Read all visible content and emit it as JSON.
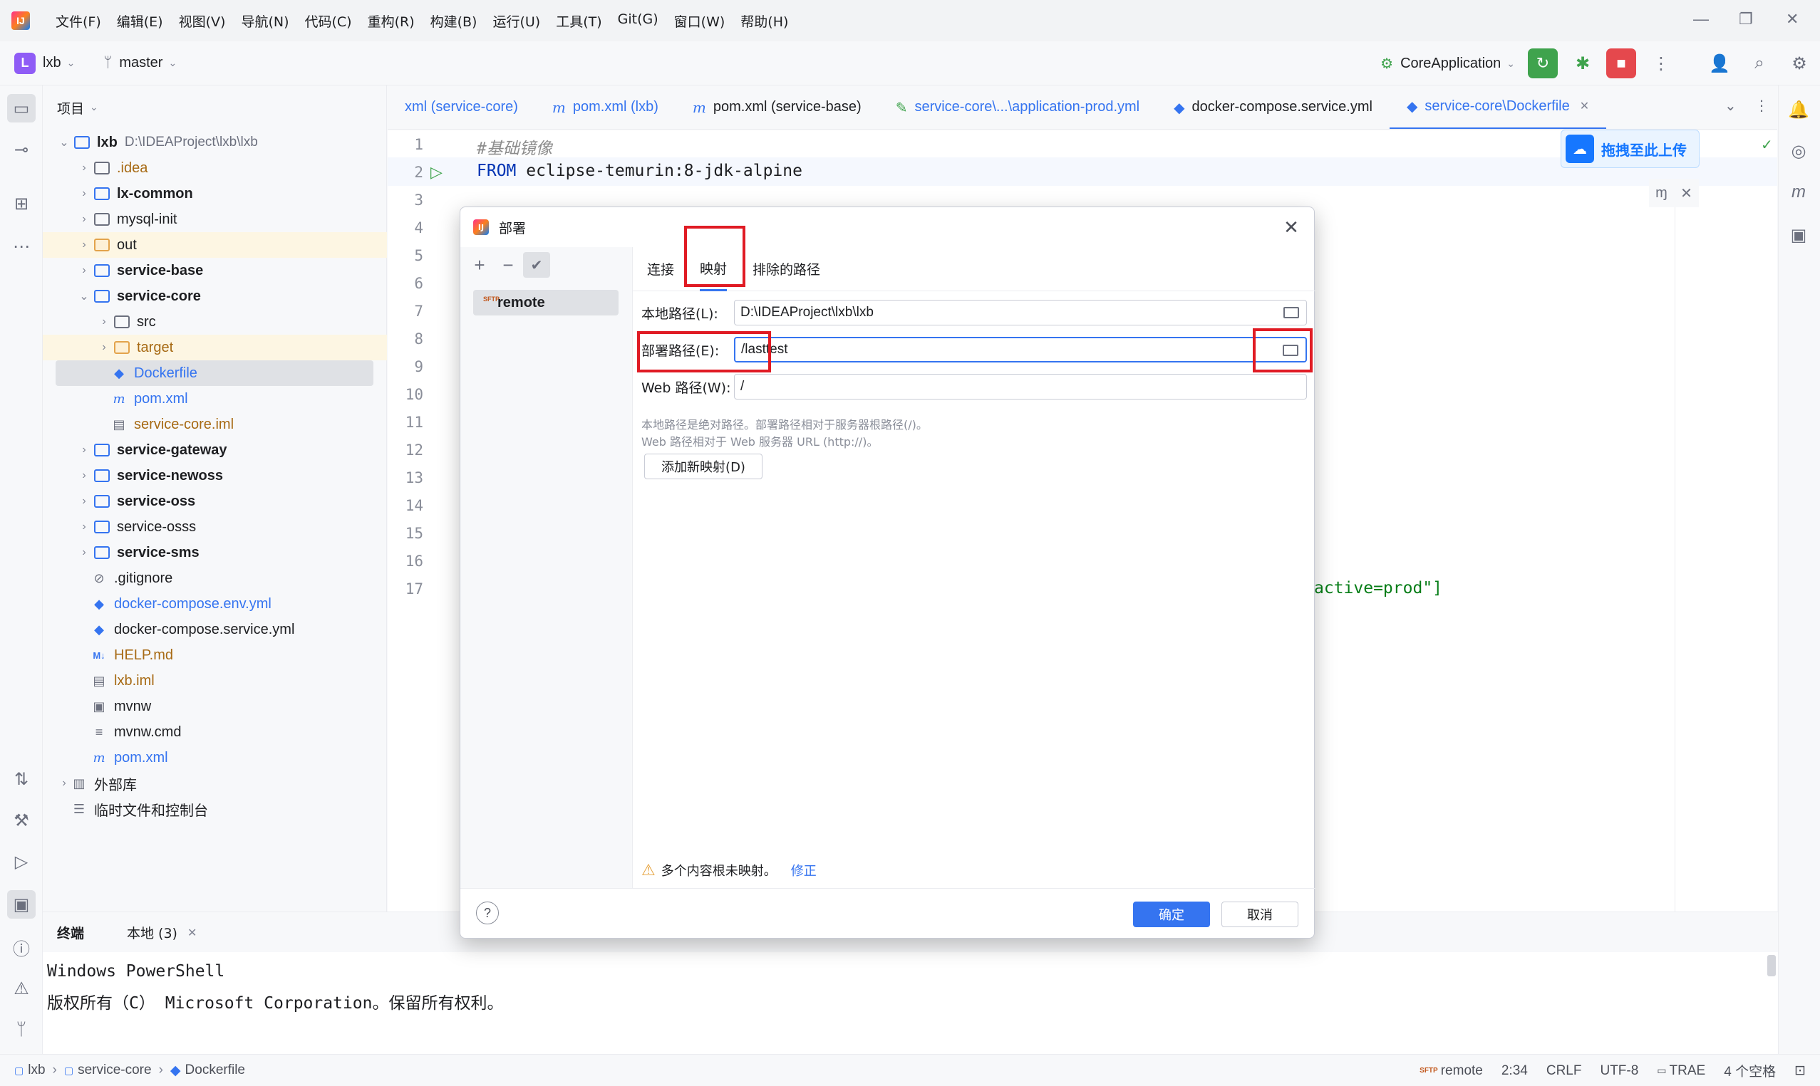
{
  "menu": [
    "文件(F)",
    "编辑(E)",
    "视图(V)",
    "导航(N)",
    "代码(C)",
    "重构(R)",
    "构建(B)",
    "运行(U)",
    "工具(T)",
    "Git(G)",
    "窗口(W)",
    "帮助(H)"
  ],
  "toolbar": {
    "project_badge": "L",
    "project_name": "lxb",
    "branch": "master",
    "run_config": "CoreApplication"
  },
  "project_panel": {
    "title": "项目",
    "tree": [
      {
        "label": "lxb",
        "sub": "D:\\IDEAProject\\lxb\\lxb",
        "depth": 0,
        "arrow": "⌄",
        "icon": "folder-mod",
        "style": "bold"
      },
      {
        "label": ".idea",
        "depth": 1,
        "arrow": "›",
        "icon": "folder",
        "style": "orange"
      },
      {
        "label": "lx-common",
        "depth": 1,
        "arrow": "›",
        "icon": "folder-mod",
        "style": "bold"
      },
      {
        "label": "mysql-init",
        "depth": 1,
        "arrow": "›",
        "icon": "folder",
        "style": ""
      },
      {
        "label": "out",
        "depth": 1,
        "arrow": "›",
        "icon": "folder-orange",
        "style": "",
        "hl": true
      },
      {
        "label": "service-base",
        "depth": 1,
        "arrow": "›",
        "icon": "folder-mod",
        "style": "bold"
      },
      {
        "label": "service-core",
        "depth": 1,
        "arrow": "⌄",
        "icon": "folder-mod",
        "style": "bold"
      },
      {
        "label": "src",
        "depth": 2,
        "arrow": "›",
        "icon": "folder",
        "style": ""
      },
      {
        "label": "target",
        "depth": 2,
        "arrow": "›",
        "icon": "folder-orange",
        "style": "orange",
        "hl": true
      },
      {
        "label": "Dockerfile",
        "depth": 2,
        "arrow": "",
        "icon": "docker",
        "style": "blue",
        "sel": true
      },
      {
        "label": "pom.xml",
        "depth": 2,
        "arrow": "",
        "icon": "maven",
        "style": "blue"
      },
      {
        "label": "service-core.iml",
        "depth": 2,
        "arrow": "",
        "icon": "file",
        "style": "orange"
      },
      {
        "label": "service-gateway",
        "depth": 1,
        "arrow": "›",
        "icon": "folder-mod",
        "style": "bold"
      },
      {
        "label": "service-newoss",
        "depth": 1,
        "arrow": "›",
        "icon": "folder-mod",
        "style": "bold"
      },
      {
        "label": "service-oss",
        "depth": 1,
        "arrow": "›",
        "icon": "folder-mod",
        "style": "bold"
      },
      {
        "label": "service-osss",
        "depth": 1,
        "arrow": "›",
        "icon": "folder-mod",
        "style": ""
      },
      {
        "label": "service-sms",
        "depth": 1,
        "arrow": "›",
        "icon": "folder-mod",
        "style": "bold"
      },
      {
        "label": ".gitignore",
        "depth": 1,
        "arrow": "",
        "icon": "ignore",
        "style": ""
      },
      {
        "label": "docker-compose.env.yml",
        "depth": 1,
        "arrow": "",
        "icon": "docker",
        "style": "blue"
      },
      {
        "label": "docker-compose.service.yml",
        "depth": 1,
        "arrow": "",
        "icon": "docker",
        "style": ""
      },
      {
        "label": "HELP.md",
        "depth": 1,
        "arrow": "",
        "icon": "md",
        "style": "orange"
      },
      {
        "label": "lxb.iml",
        "depth": 1,
        "arrow": "",
        "icon": "file",
        "style": "orange"
      },
      {
        "label": "mvnw",
        "depth": 1,
        "arrow": "",
        "icon": "terminal",
        "style": ""
      },
      {
        "label": "mvnw.cmd",
        "depth": 1,
        "arrow": "",
        "icon": "lines",
        "style": ""
      },
      {
        "label": "pom.xml",
        "depth": 1,
        "arrow": "",
        "icon": "maven",
        "style": "blue"
      },
      {
        "label": "外部库",
        "depth": 0,
        "arrow": "›",
        "icon": "library",
        "style": ""
      },
      {
        "label": "临时文件和控制台",
        "depth": 0,
        "arrow": "",
        "icon": "scratch",
        "style": ""
      }
    ]
  },
  "tabs": [
    {
      "label": "xml (service-core)",
      "icon": "",
      "active": false
    },
    {
      "label": "pom.xml (lxb)",
      "icon": "m",
      "active": false
    },
    {
      "label": "pom.xml (service-base)",
      "icon": "m",
      "active": false,
      "dark": true
    },
    {
      "label": "service-core\\...\\application-prod.yml",
      "icon": "yml",
      "active": false
    },
    {
      "label": "docker-compose.service.yml",
      "icon": "docker",
      "active": false,
      "dark": true
    },
    {
      "label": "service-core\\Dockerfile",
      "icon": "docker",
      "active": true
    }
  ],
  "editor": {
    "line_numbers": [
      "1",
      "2",
      "3",
      "4",
      "5",
      "6",
      "7",
      "8",
      "9",
      "10",
      "11",
      "12",
      "13",
      "14",
      "15",
      "16",
      "17"
    ],
    "line1_comment": "#基础镜像",
    "line2_keyword": "FROM",
    "line2_rest": " eclipse-temurin:8-jdk-alpine",
    "line17_tail": "active=prod\"]",
    "upload_label": "拖拽至此上传"
  },
  "dialog": {
    "title": "部署",
    "server": "remote",
    "tabs": [
      "连接",
      "映射",
      "排除的路径"
    ],
    "active_tab": "映射",
    "local_path_label": "本地路径(L):",
    "local_path": "D:\\IDEAProject\\lxb\\lxb",
    "deploy_path_label": "部署路径(E):",
    "deploy_path": "/lasttest",
    "web_path_label": "Web 路径(W):",
    "web_path": "/",
    "hint1": "本地路径是绝对路径。部署路径相对于服务器根路径(/)。",
    "hint2": "Web 路径相对于 Web 服务器 URL (http://)。",
    "add_mapping": "添加新映射(D)",
    "warning": "多个内容根未映射。",
    "fix_link": "修正",
    "ok": "确定",
    "cancel": "取消"
  },
  "terminal": {
    "title": "终端",
    "tab": "本地 (3)",
    "lines": [
      "Windows PowerShell",
      "版权所有（C） Microsoft Corporation。保留所有权利。"
    ]
  },
  "statusbar": {
    "crumbs": [
      "lxb",
      "service-core",
      "Dockerfile"
    ],
    "server": "remote",
    "position": "2:34",
    "line_sep": "CRLF",
    "encoding": "UTF-8",
    "plugin": "TRAE",
    "indent": "4 个空格"
  },
  "colors": {
    "accent": "#3574f0",
    "annotation": "#e01b24",
    "run_green": "#3fa34d",
    "stop_red": "#e5484d"
  }
}
